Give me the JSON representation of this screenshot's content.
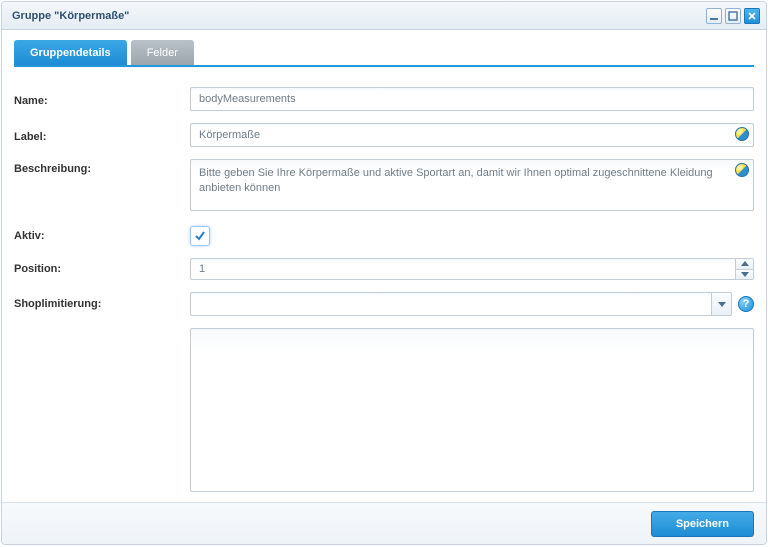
{
  "window": {
    "title": "Gruppe \"Körpermaße\""
  },
  "tabs": {
    "details": "Gruppendetails",
    "fields": "Felder"
  },
  "labels": {
    "name": "Name:",
    "label": "Label:",
    "description": "Beschreibung:",
    "active": "Aktiv:",
    "position": "Position:",
    "shoplimit": "Shoplimitierung:"
  },
  "values": {
    "name": "bodyMeasurements",
    "label": "Körpermaße",
    "description": "Bitte geben Sie Ihre Körpermaße und aktive Sportart an, damit wir Ihnen optimal zugeschnittene Kleidung anbieten können",
    "active": true,
    "position": "1",
    "shoplimit": ""
  },
  "buttons": {
    "save": "Speichern"
  },
  "help": {
    "glyph": "?"
  }
}
